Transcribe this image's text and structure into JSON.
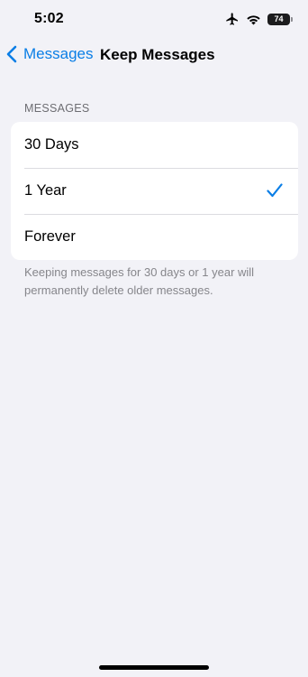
{
  "status_bar": {
    "time": "5:02",
    "battery_level": "74",
    "icons": [
      "airplane-icon",
      "wifi-icon",
      "battery-icon"
    ]
  },
  "nav": {
    "back_label": "Messages",
    "title": "Keep Messages",
    "accent_color": "#0a7ee6"
  },
  "section": {
    "header": "MESSAGES",
    "options": [
      {
        "label": "30 Days",
        "selected": false
      },
      {
        "label": "1 Year",
        "selected": true
      },
      {
        "label": "Forever",
        "selected": false
      }
    ],
    "footer": "Keeping messages for 30 days or 1 year will permanently delete older messages."
  }
}
